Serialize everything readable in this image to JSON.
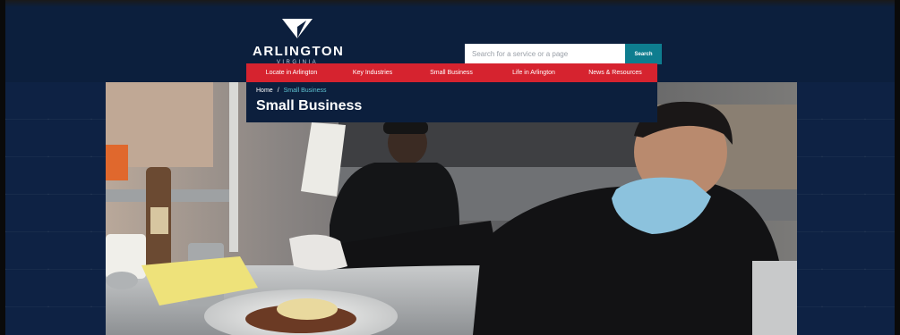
{
  "logo": {
    "name": "ARLINGTON",
    "subtitle": "VIRGINIA",
    "icon": "arlington-chevron-logo"
  },
  "search": {
    "placeholder": "Search for a service or a page",
    "value": "",
    "button_label": "Search"
  },
  "nav": {
    "items": [
      {
        "label": "Locate in Arlington"
      },
      {
        "label": "Key Industries"
      },
      {
        "label": "Small Business"
      },
      {
        "label": "Life in Arlington"
      },
      {
        "label": "News & Resources"
      }
    ]
  },
  "breadcrumb": {
    "home": "Home",
    "separator": "/",
    "current": "Small Business"
  },
  "page": {
    "title": "Small Business"
  },
  "hero": {
    "image_subject": "chef-in-mask-garnishing-plate"
  },
  "colors": {
    "navy": "#0c1f3d",
    "nav_red": "#d6232f",
    "search_teal": "#0e7d8f",
    "breadcrumb_current": "#5fc3d2"
  }
}
